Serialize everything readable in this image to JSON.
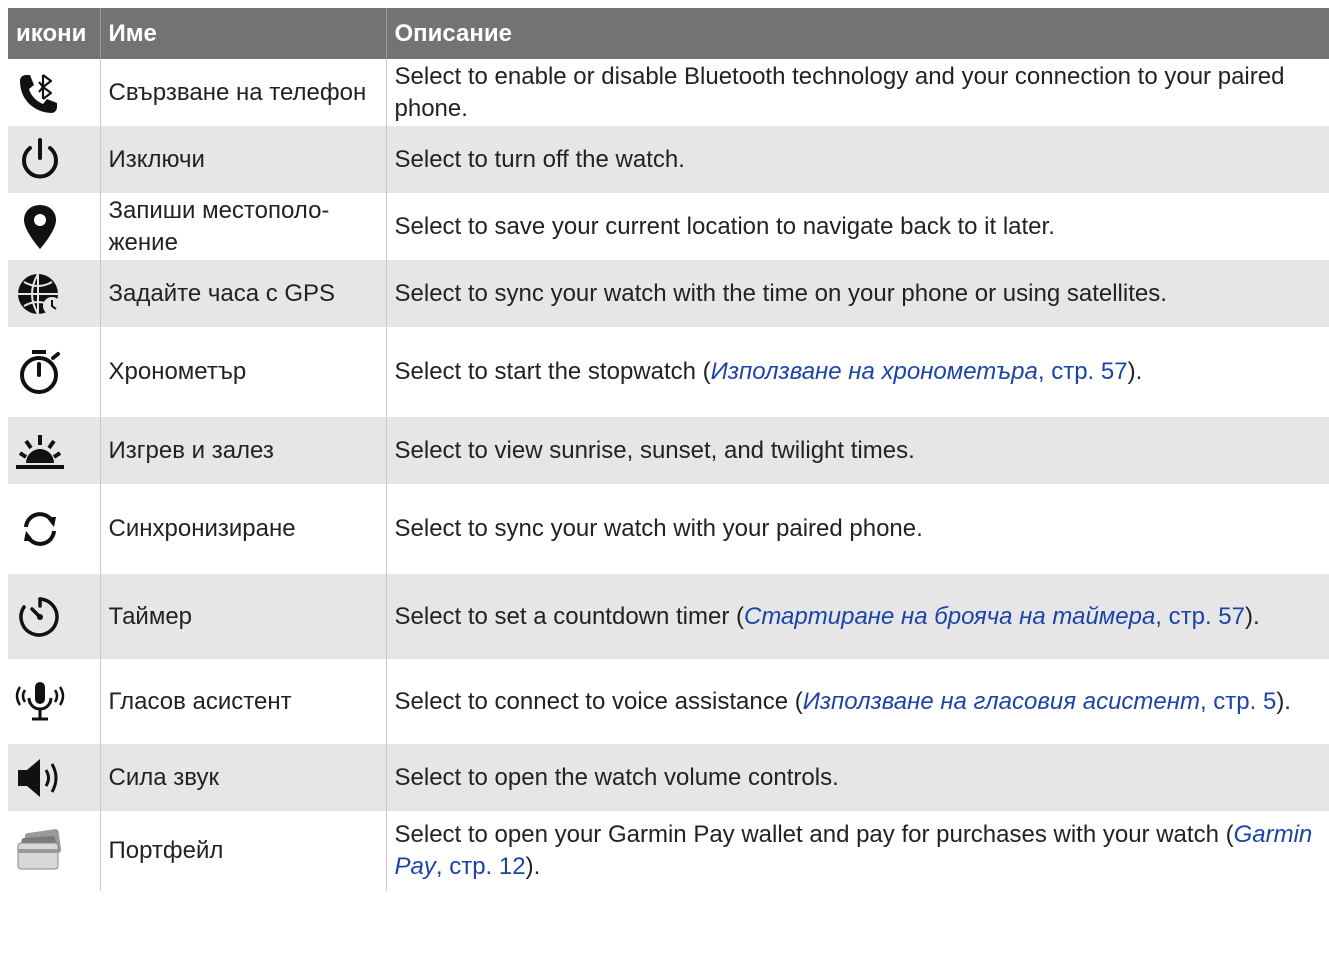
{
  "table": {
    "headers": {
      "icons": "икони",
      "name": "Име",
      "description": "Описание"
    },
    "rows": [
      {
        "icon": "phone-bluetooth-icon",
        "name": "Свързване на телефон",
        "description": "Select to enable or disable Bluetooth technology and your connection to your paired phone."
      },
      {
        "icon": "power-icon",
        "name": "Изключи",
        "description": "Select to turn off the watch."
      },
      {
        "icon": "location-pin-icon",
        "name": "Запиши местополо-жение",
        "description": "Select to save your current location to navigate back to it later."
      },
      {
        "icon": "globe-gps-icon",
        "name": "Задайте часа с GPS",
        "description": "Select to sync your watch with the time on your phone or using satellites."
      },
      {
        "icon": "stopwatch-icon",
        "name": "Хронометър",
        "description_pre": "Select to start the stopwatch (",
        "link_text": "Използване на хронометъра",
        "link_page": ", стр. 57",
        "description_post": ")."
      },
      {
        "icon": "sunrise-icon",
        "name": "Изгрев и залез",
        "description": "Select to view sunrise, sunset, and twilight times."
      },
      {
        "icon": "sync-icon",
        "name": "Синхронизиране",
        "description": "Select to sync your watch with your paired phone."
      },
      {
        "icon": "timer-icon",
        "name": "Таймер",
        "description_pre": "Select to set a countdown timer (",
        "link_text": "Стартиране на брояча на таймера",
        "link_page": ", стр. 57",
        "description_post": ")."
      },
      {
        "icon": "voice-assistant-icon",
        "name": "Гласов асистент",
        "description_pre": "Select to connect to voice assistance (",
        "link_text": "Използване на гласовия асистент",
        "link_page": ", стр. 5",
        "description_post": ")."
      },
      {
        "icon": "volume-icon",
        "name": "Сила звук",
        "description": "Select to open the watch volume controls."
      },
      {
        "icon": "wallet-icon",
        "name": "Портфейл",
        "description_pre": "Select to open your Garmin Pay wallet and pay for purchases with your watch (",
        "link_text": "Garmin Pay",
        "link_page": ", стр. 12",
        "description_post": ")."
      }
    ]
  },
  "colors": {
    "header_bg": "#737373",
    "row_shade": "#e6e6e6",
    "link": "#1a44a8"
  }
}
